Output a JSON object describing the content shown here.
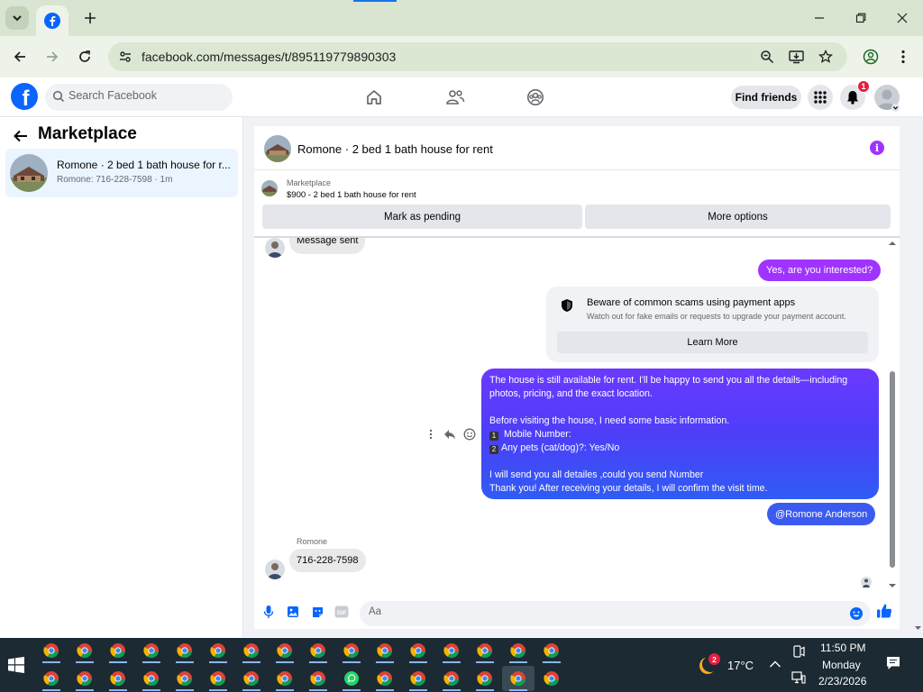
{
  "browser": {
    "url": "facebook.com/messages/t/895119779890303"
  },
  "fb": {
    "search_placeholder": "Search Facebook",
    "find_friends": "Find friends",
    "notif_count": "1"
  },
  "left": {
    "title": "Marketplace",
    "conversation": {
      "name": "Romone · 2 bed 1 bath house for r...",
      "sub": "Romone: 716-228-7598 · 1m"
    }
  },
  "chat": {
    "title": "Romone · 2 bed 1 bath house for rent",
    "marketplace_label": "Marketplace",
    "listing": "$900 - 2 bed 1 bath house for rent",
    "mark_pending": "Mark as pending",
    "more_options": "More options",
    "messages": {
      "partial_in": "Message sent",
      "out1": "Yes, are you interested?",
      "scam_title": "Beware of common scams using payment apps",
      "scam_sub": "Watch out for fake emails or requests to upgrade your payment account.",
      "learn_more": "Learn More",
      "long": {
        "l1": "The house is still available for rent. I'll be happy to send you all the details—including",
        "l2": "photos, pricing, and the exact location.",
        "l3": "Before visiting the house, I need some basic information.",
        "k1": "1",
        "l4": " Mobile Number:",
        "k2": "2",
        "l5": "Any pets (cat/dog)?: Yes/No",
        "l6": "I will send you all detailes ,could you send Number",
        "l7": "Thank you! After receiving your details, I will confirm the visit time."
      },
      "mention": "@Romone Anderson",
      "sender": "Romone",
      "phone": "716-228-7598"
    },
    "composer_placeholder": "Aa",
    "gif_label": "GIF"
  },
  "taskbar": {
    "weather_badge": "2",
    "temp": "17°C",
    "time": "11:50 PM",
    "day": "Monday",
    "date": "2/23/2026"
  },
  "colors": {
    "fb_blue": "#0866ff",
    "messenger_purple": "#a033ff",
    "bubble_grad_top": "#6b39ff",
    "bubble_grad_bottom": "#2f5cf5",
    "mention_blue": "#3b5bf0"
  }
}
